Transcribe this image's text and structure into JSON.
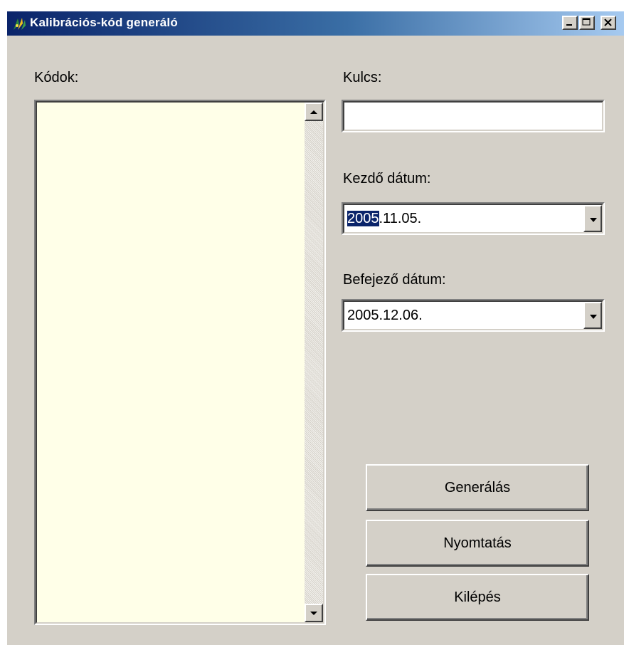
{
  "window": {
    "title": "Kalibrációs-kód generáló",
    "icon": "app-icon",
    "controls": [
      "minimize",
      "maximize",
      "close"
    ]
  },
  "codes": {
    "label": "Kódok:",
    "items": []
  },
  "key": {
    "label": "Kulcs:",
    "value": ""
  },
  "start_date": {
    "label": "Kezdő dátum:",
    "value_selected": "2005",
    "value_rest": ".11.05."
  },
  "end_date": {
    "label": "Befejező dátum:",
    "value": "2005.12.06."
  },
  "buttons": {
    "generate": "Generálás",
    "print": "Nyomtatás",
    "exit": "Kilépés"
  },
  "colors": {
    "title_gradient_start": "#0a246a",
    "title_gradient_end": "#a6caf0",
    "face": "#d4d0c8",
    "listbox_bg": "#ffffe8",
    "selection": "#0a246a"
  }
}
